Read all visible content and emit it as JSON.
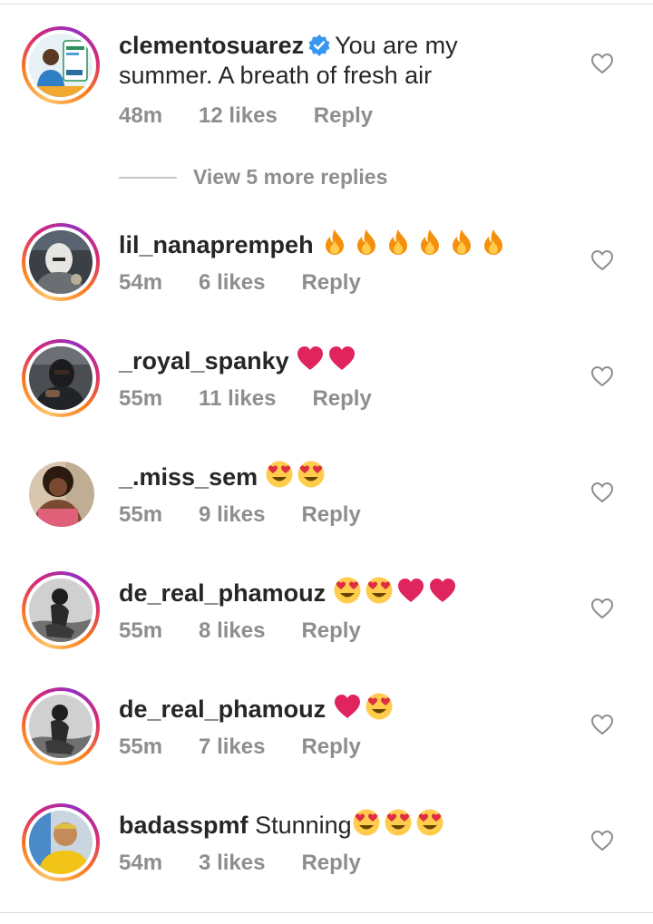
{
  "comments": [
    {
      "username": "clementosuarez",
      "verified": true,
      "text_line1": "You are my",
      "text_line2": "summer. A breath of fresh air",
      "time": "48m",
      "likes": "12 likes",
      "reply": "Reply",
      "avatar_icon": "user-avatar-photo",
      "emojis": []
    },
    {
      "username": "lil_nanaprempeh",
      "text": "",
      "emojis": [
        "fire",
        "fire",
        "fire",
        "fire",
        "fire",
        "fire"
      ],
      "time": "54m",
      "likes": "6 likes",
      "reply": "Reply"
    },
    {
      "username": "_royal_spanky",
      "text": "",
      "emojis": [
        "red-heart",
        "red-heart"
      ],
      "time": "55m",
      "likes": "11 likes",
      "reply": "Reply"
    },
    {
      "username": "_.miss_sem",
      "text": "",
      "emojis": [
        "heart-eyes",
        "heart-eyes"
      ],
      "time": "55m",
      "likes": "9 likes",
      "reply": "Reply"
    },
    {
      "username": "de_real_phamouz",
      "text": "",
      "emojis": [
        "heart-eyes",
        "heart-eyes",
        "red-heart",
        "red-heart"
      ],
      "time": "55m",
      "likes": "8 likes",
      "reply": "Reply"
    },
    {
      "username": "de_real_phamouz",
      "text": "",
      "emojis": [
        "red-heart",
        "heart-eyes"
      ],
      "time": "55m",
      "likes": "7 likes",
      "reply": "Reply"
    },
    {
      "username": "badasspmf",
      "text": "Stunning",
      "emojis": [
        "heart-eyes",
        "heart-eyes",
        "heart-eyes"
      ],
      "time": "54m",
      "likes": "3 likes",
      "reply": "Reply"
    }
  ],
  "view_more_replies": "View 5 more replies",
  "colors": {
    "username": "#262626",
    "meta": "#8e8e8e",
    "verified": "#3897f0",
    "heart_emoji": "#e0245e",
    "fire_emoji": "#f4900c"
  }
}
